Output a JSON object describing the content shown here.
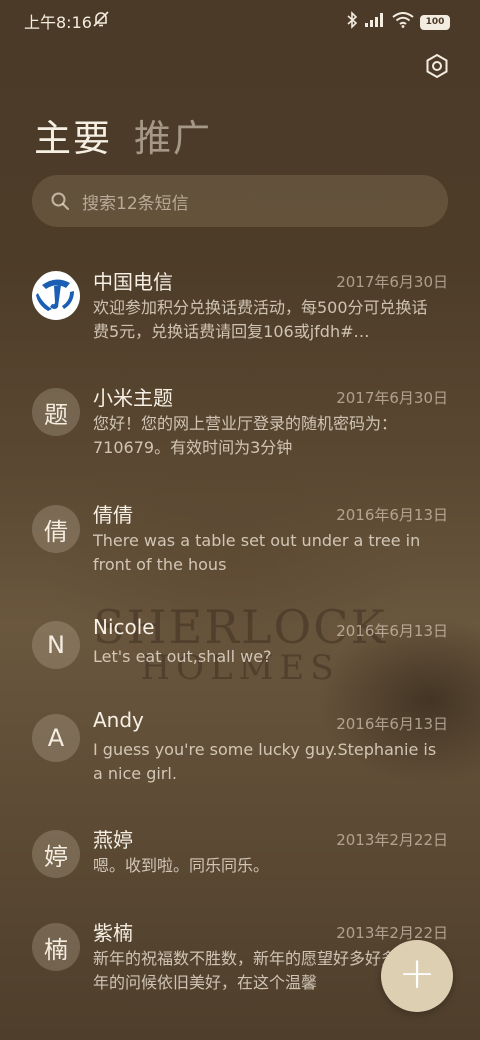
{
  "status_bar": {
    "time": "上午8:16",
    "battery": "100"
  },
  "tabs": [
    {
      "label": "主要",
      "active": true
    },
    {
      "label": "推广",
      "active": false
    }
  ],
  "search": {
    "placeholder": "搜索12条短信",
    "icon": "search-icon"
  },
  "conversations": [
    {
      "avatar": "",
      "avatar_icon": "china-telecom-logo",
      "name": "中国电信",
      "date": "2017年6月30日",
      "snippet": "欢迎参加积分兑换话费活动，每500分可兑换话费5元，兑换话费请回复106或jfdh#…"
    },
    {
      "avatar": "题",
      "name": "小米主题",
      "date": "2017年6月30日",
      "snippet": "您好！您的网上营业厅登录的随机密码为：710679。有效时间为3分钟"
    },
    {
      "avatar": "倩",
      "name": "倩倩",
      "date": "2016年6月13日",
      "snippet": "There was a table set out under a tree in front of the hous"
    },
    {
      "avatar": "N",
      "name": "Nicole",
      "date": "2016年6月13日",
      "snippet": "Let's eat out,shall we?"
    },
    {
      "avatar": "A",
      "name": "Andy",
      "date": "2016年6月13日",
      "snippet": "I guess you're some lucky guy.Stephanie is a nice girl."
    },
    {
      "avatar": "婷",
      "name": "燕婷",
      "date": "2013年2月22日",
      "snippet": "嗯。收到啦。同乐同乐。"
    },
    {
      "avatar": "楠",
      "name": "紫楠",
      "date": "2013年2月22日",
      "snippet": "新年的祝福数不胜数，新年的愿望好多好多，新年的问候依旧美好，在这个温馨"
    }
  ],
  "wallpaper": {
    "line1": "SHERLOCK",
    "line2": "HOLMES"
  },
  "fab": {
    "label": "+",
    "icon": "plus-icon"
  },
  "colors": {
    "accent": "#dccfb2",
    "background": "#4d3c28"
  }
}
